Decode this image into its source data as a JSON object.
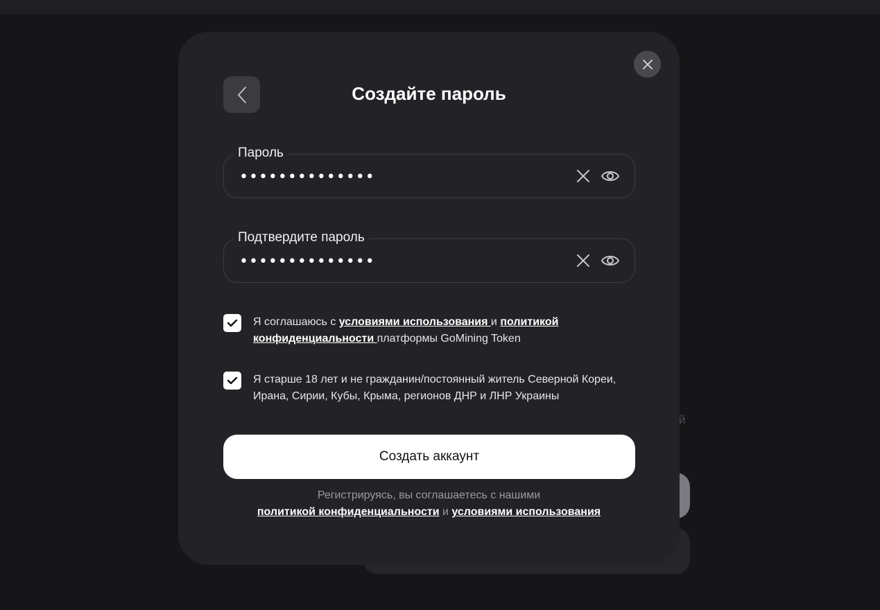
{
  "background": {
    "partial_text": "й"
  },
  "modal": {
    "title": "Создайте пароль",
    "password_field": {
      "label": "Пароль",
      "value": "••••••••••••••"
    },
    "confirm_field": {
      "label": "Подтвердите пароль",
      "value": "••••••••••••••"
    },
    "terms_checkbox": {
      "checked": true,
      "text_before": "Я соглашаюсь с ",
      "link1": "условиями использования ",
      "text_mid": "и ",
      "link2": "политикой конфиденциальности ",
      "text_after": "платформы GoMining Token"
    },
    "age_checkbox": {
      "checked": true,
      "text": "Я старше 18 лет и не гражданин/постоянный житель Северной Кореи, Ирана, Сирии, Кубы, Крыма, регионов ДНР и ЛНР Украины"
    },
    "create_button_label": "Создать аккаунт",
    "footer": {
      "line1": "Регистрируясь, вы соглашаетесь с нашими",
      "privacy_link": "политикой конфиденциальности",
      "conj": " и ",
      "terms_link": "условиями использования"
    }
  },
  "colors": {
    "page_bg": "#161618",
    "modal_bg": "#232327",
    "button_bg": "#ffffff",
    "field_border": "#3c3c42"
  },
  "icons": [
    "close-icon",
    "chevron-left-icon",
    "clear-icon",
    "eye-icon",
    "checkmark-icon"
  ]
}
